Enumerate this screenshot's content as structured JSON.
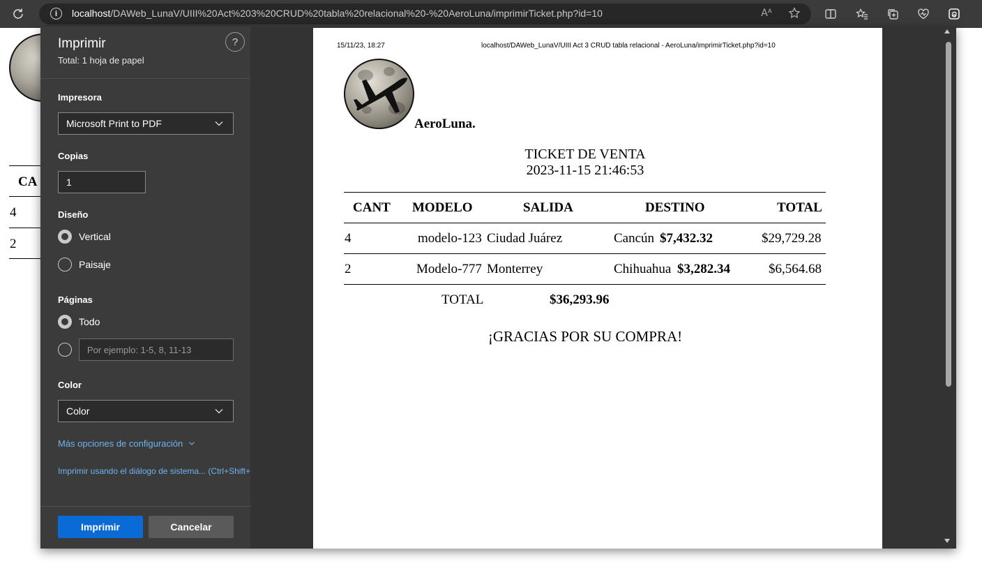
{
  "browser": {
    "url_host": "localhost",
    "url_path": "/DAWeb_LunaV/UIII%20Act%203%20CRUD%20tabla%20relacional%20-%20AeroLuna/imprimirTicket.php?id=10",
    "read_aloud_icon": "Aᴬ"
  },
  "background_page": {
    "header_fragment": "CA",
    "rows": [
      "4",
      "2"
    ]
  },
  "print_panel": {
    "title": "Imprimir",
    "subtitle": "Total: 1 hoja de papel",
    "help": "?",
    "printer_label": "Impresora",
    "printer_value": "Microsoft Print to PDF",
    "copies_label": "Copias",
    "copies_value": "1",
    "layout_label": "Diseño",
    "layout_options": [
      "Vertical",
      "Paisaje"
    ],
    "layout_selected": "Vertical",
    "pages_label": "Páginas",
    "pages_all": "Todo",
    "pages_placeholder": "Por ejemplo: 1-5, 8, 11-13",
    "color_label": "Color",
    "color_value": "Color",
    "more_settings": "Más opciones de configuración",
    "system_dialog": "Imprimir usando el diálogo de sistema... (Ctrl+Shift+P)",
    "print_button": "Imprimir",
    "cancel_button": "Cancelar"
  },
  "preview": {
    "header_date": "15/11/23, 18:27",
    "header_url": "localhost/DAWeb_LunaV/UIII Act 3 CRUD tabla relacional - AeroLuna/imprimirTicket.php?id=10",
    "brand": "AeroLuna.",
    "ticket_title": "TICKET DE VENTA",
    "ticket_datetime": "2023-11-15 21:46:53",
    "columns": [
      "CANT",
      "MODELO",
      "SALIDA",
      "DESTINO",
      "TOTAL"
    ],
    "rows": [
      {
        "cant": "4",
        "modelo": "modelo-123",
        "salida": "Ciudad Juárez",
        "destino": "Cancún",
        "precio": "$7,432.32",
        "total": "$29,729.28"
      },
      {
        "cant": "2",
        "modelo": "Modelo-777",
        "salida": "Monterrey",
        "destino": "Chihuahua",
        "precio": "$3,282.34",
        "total": "$6,564.68"
      }
    ],
    "total_label": "TOTAL",
    "total_value": "$36,293.96",
    "thanks": "¡GRACIAS POR SU COMPRA!"
  }
}
